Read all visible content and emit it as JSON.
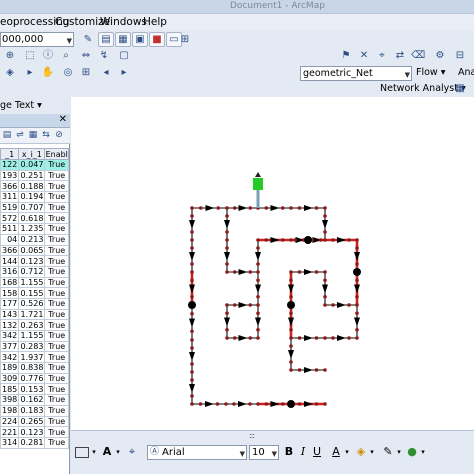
{
  "window": {
    "title": "Document1 - ArcMap"
  },
  "menu": {
    "items": [
      "eoprocessing",
      "Customize",
      "Windows",
      "Help"
    ]
  },
  "toolbar": {
    "scale": "000,000",
    "geometric_network": "geometric_Net",
    "flow_label": "Flow",
    "right_cut": "Anal",
    "network_analyst": "Network Analyst"
  },
  "label_toolbar": {
    "label": "ge Text"
  },
  "table": {
    "headers": [
      "_1",
      "x_i_1",
      "Enabl"
    ],
    "rows": [
      [
        "122",
        "0.047",
        "True"
      ],
      [
        "193",
        "0.251",
        "True"
      ],
      [
        "366",
        "0.188",
        "True"
      ],
      [
        "311",
        "0.194",
        "True"
      ],
      [
        "519",
        "0.707",
        "True"
      ],
      [
        "572",
        "0.618",
        "True"
      ],
      [
        "511",
        "1.235",
        "True"
      ],
      [
        "04",
        "0.213",
        "True"
      ],
      [
        "366",
        "0.065",
        "True"
      ],
      [
        "144",
        "0.123",
        "True"
      ],
      [
        "316",
        "0.712",
        "True"
      ],
      [
        "168",
        "1.155",
        "True"
      ],
      [
        "158",
        "0.155",
        "True"
      ],
      [
        "177",
        "0.526",
        "True"
      ],
      [
        "143",
        "1.721",
        "True"
      ],
      [
        "132",
        "0.263",
        "True"
      ],
      [
        "342",
        "1.155",
        "True"
      ],
      [
        "377",
        "0.283",
        "True"
      ],
      [
        "342",
        "1.937",
        "True"
      ],
      [
        "189",
        "0.838",
        "True"
      ],
      [
        "309",
        "0.776",
        "True"
      ],
      [
        "185",
        "0.153",
        "True"
      ],
      [
        "398",
        "0.162",
        "True"
      ],
      [
        "198",
        "0.183",
        "True"
      ],
      [
        "224",
        "0.265",
        "True"
      ],
      [
        "221",
        "0.123",
        "True"
      ],
      [
        "314",
        "0.281",
        "True"
      ]
    ]
  },
  "drawing": {
    "font": "Arial",
    "size": "10",
    "bold": "B",
    "italic": "I",
    "underline": "U",
    "text_tool": "A"
  },
  "colors": {
    "highlight_row": "#9ef0e6",
    "edge_normal": "#0a0a0a",
    "edge_selected": "#d02020",
    "flag_green": "#22cc22",
    "network_gray": "#7aa0b8"
  },
  "splitter_grip": ":::"
}
